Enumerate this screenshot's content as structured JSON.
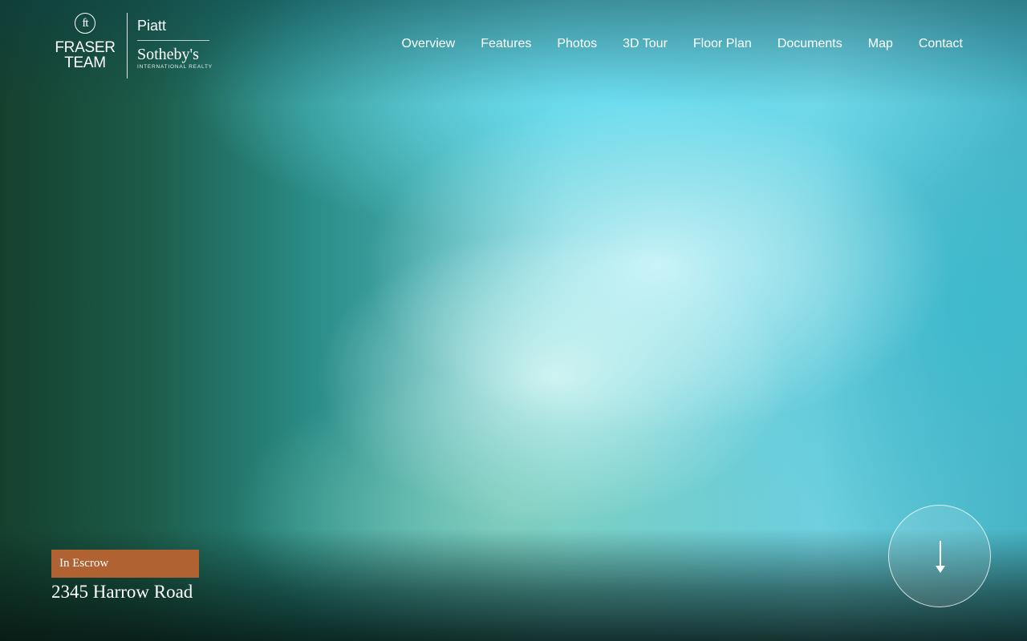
{
  "brand": {
    "mark_glyph": "ft",
    "team_line1": "FRASER",
    "team_line2": "TEAM",
    "partner_line1": "Piatt",
    "partner_line2": "Sotheby's",
    "partner_line3": "INTERNATIONAL REALTY"
  },
  "nav": {
    "items": [
      {
        "label": "Overview"
      },
      {
        "label": "Features"
      },
      {
        "label": "Photos"
      },
      {
        "label": "3D Tour"
      },
      {
        "label": "Floor Plan"
      },
      {
        "label": "Documents"
      },
      {
        "label": "Map"
      },
      {
        "label": "Contact"
      }
    ]
  },
  "listing": {
    "status": "In Escrow",
    "address": "2345 Harrow Road"
  },
  "icons": {
    "scroll": "arrow-down-icon"
  },
  "colors": {
    "status_badge": "#b06232",
    "text": "#ffffff"
  }
}
